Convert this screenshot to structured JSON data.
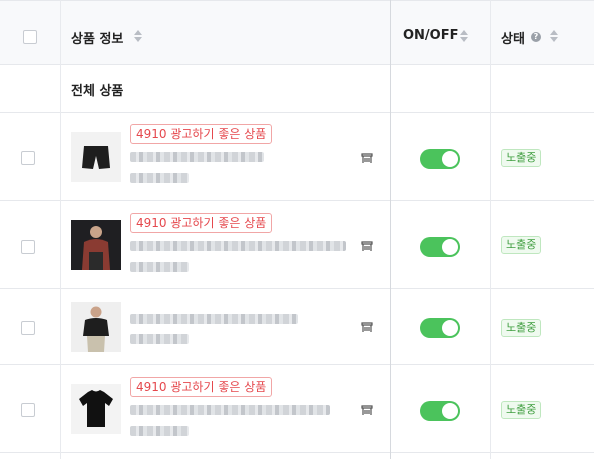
{
  "header": {
    "product_info": "상품 정보",
    "onoff": "ON/OFF",
    "status": "상태",
    "help_glyph": "?"
  },
  "all_products_label": "전체 상품",
  "rows": [
    {
      "badge": "4910 광고하기 좋은 상품",
      "toggle_on": true,
      "status": "노출중",
      "thumb_icon": "shorts-image"
    },
    {
      "badge": "4910 광고하기 좋은 상품",
      "toggle_on": true,
      "status": "노출중",
      "thumb_icon": "man-shirt-image"
    },
    {
      "badge": "",
      "toggle_on": true,
      "status": "노출중",
      "thumb_icon": "man-tshirt-image"
    },
    {
      "badge": "4910 광고하기 좋은 상품",
      "toggle_on": true,
      "status": "노출중",
      "thumb_icon": "black-tshirt-image"
    }
  ],
  "colors": {
    "toggle_on": "#4bc35c",
    "badge_red": "#e5484d",
    "status_green": "#3f9d3f"
  }
}
